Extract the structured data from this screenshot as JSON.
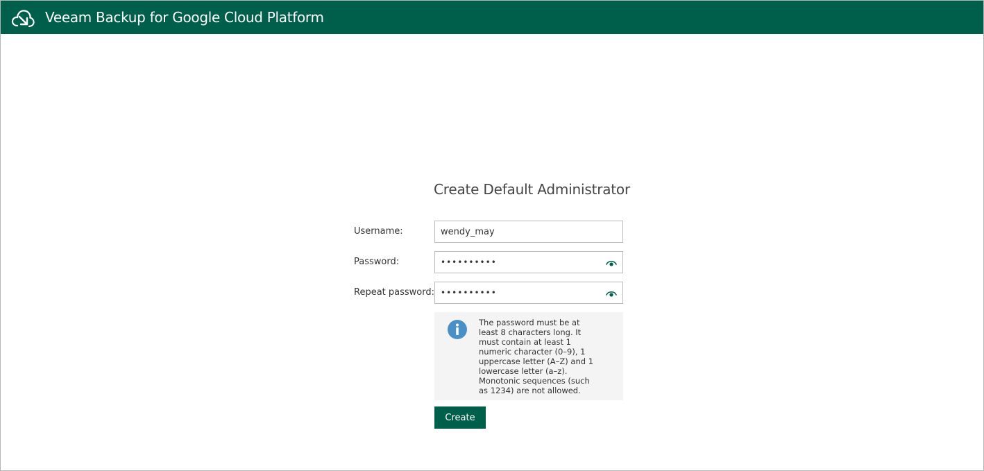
{
  "header": {
    "app_title": "Veeam Backup for Google Cloud Platform",
    "logo_icon": "veeam-cloud-logo-icon",
    "bg_color": "#005f4b"
  },
  "form": {
    "title": "Create Default Administrator",
    "username": {
      "label": "Username:",
      "value": "wendy_may"
    },
    "password": {
      "label": "Password:",
      "value": "••••••••••",
      "reveal_icon": "eye-icon"
    },
    "repeat_password": {
      "label": "Repeat password:",
      "value": "••••••••••",
      "reveal_icon": "eye-icon"
    },
    "info": {
      "icon": "info-icon",
      "text": "The password must be at least 8 characters long. It must contain at least 1 numeric character (0–9), 1 uppercase letter (A–Z) and 1 lowercase letter (a–z). Monotonic sequences (such as 1234) are not allowed."
    },
    "create_label": "Create"
  },
  "colors": {
    "brand": "#005f4b",
    "info_blue": "#4a90c8",
    "info_bg": "#f4f4f4"
  }
}
